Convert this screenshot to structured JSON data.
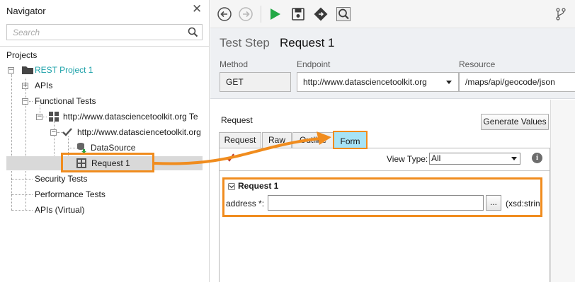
{
  "navigator": {
    "title": "Navigator",
    "search_placeholder": "Search",
    "projects_label": "Projects",
    "tree": {
      "project": "REST Project 1",
      "apis": "APIs",
      "functional_tests": "Functional Tests",
      "test_suite": "http://www.datasciencetoolkit.org Te",
      "test_case": "http://www.datasciencetoolkit.org",
      "datasource": "DataSource",
      "request": "Request 1",
      "security_tests": "Security Tests",
      "performance_tests": "Performance Tests",
      "apis_virtual": "APIs (Virtual)"
    }
  },
  "toolbar": {
    "icons": [
      "back-icon",
      "forward-icon",
      "run-icon",
      "save-icon",
      "diamond-icon",
      "inspect-icon",
      "branch-icon"
    ]
  },
  "step": {
    "prefix": "Test Step",
    "name": "Request 1",
    "method_label": "Method",
    "method_value": "GET",
    "endpoint_label": "Endpoint",
    "endpoint_value": "http://www.datasciencetoolkit.org",
    "resource_label": "Resource",
    "resource_value": "/maps/api/geocode/json"
  },
  "request_panel": {
    "title": "Request",
    "generate_values": "Generate Values",
    "tabs": [
      "Request",
      "Raw",
      "Outline",
      "Form"
    ],
    "active_tab": "Form",
    "view_type_label": "View Type:",
    "view_type_value": "All",
    "form_title": "Request 1",
    "address_label": "address *:",
    "address_value": "",
    "ellipsis_label": "...",
    "type_label": "(xsd:string)"
  },
  "colors": {
    "accent_orange": "#f08c1e",
    "project_teal": "#1aa0a8",
    "form_tab_blue": "#a6e3f6",
    "run_green": "#22a845"
  }
}
